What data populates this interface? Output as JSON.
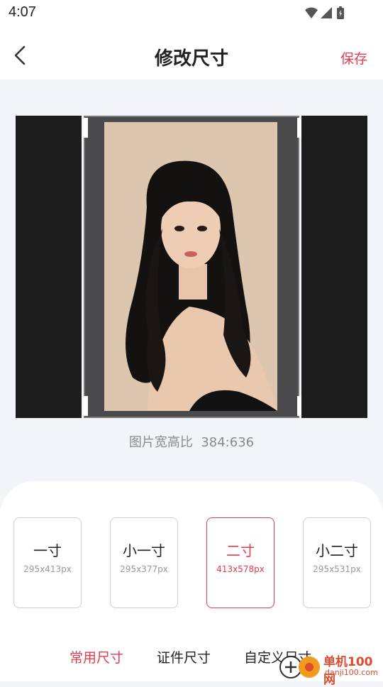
{
  "status_bar": {
    "time": "4:07"
  },
  "nav": {
    "title": "修改尺寸",
    "save_label": "保存"
  },
  "editor": {
    "ratio_label": "图片宽高比",
    "ratio_value": "384:636"
  },
  "sizes": [
    {
      "name": "一寸",
      "px": "295x413px",
      "selected": false
    },
    {
      "name": "小一寸",
      "px": "295x377px",
      "selected": false
    },
    {
      "name": "二寸",
      "px": "413x578px",
      "selected": true
    },
    {
      "name": "小二寸",
      "px": "295x531px",
      "selected": false
    }
  ],
  "tabs": [
    {
      "label": "常用尺寸",
      "active": true
    },
    {
      "label": "证件尺寸",
      "active": false
    },
    {
      "label": "自定义尺寸",
      "active": false
    }
  ],
  "watermark": {
    "name": "单机100网",
    "url": "danji100.com"
  },
  "colors": {
    "accent": "#e83a4e",
    "panel": "#1c1c1c",
    "frame": "#4a4a4c",
    "photo_bg": "#dcc6b0"
  }
}
